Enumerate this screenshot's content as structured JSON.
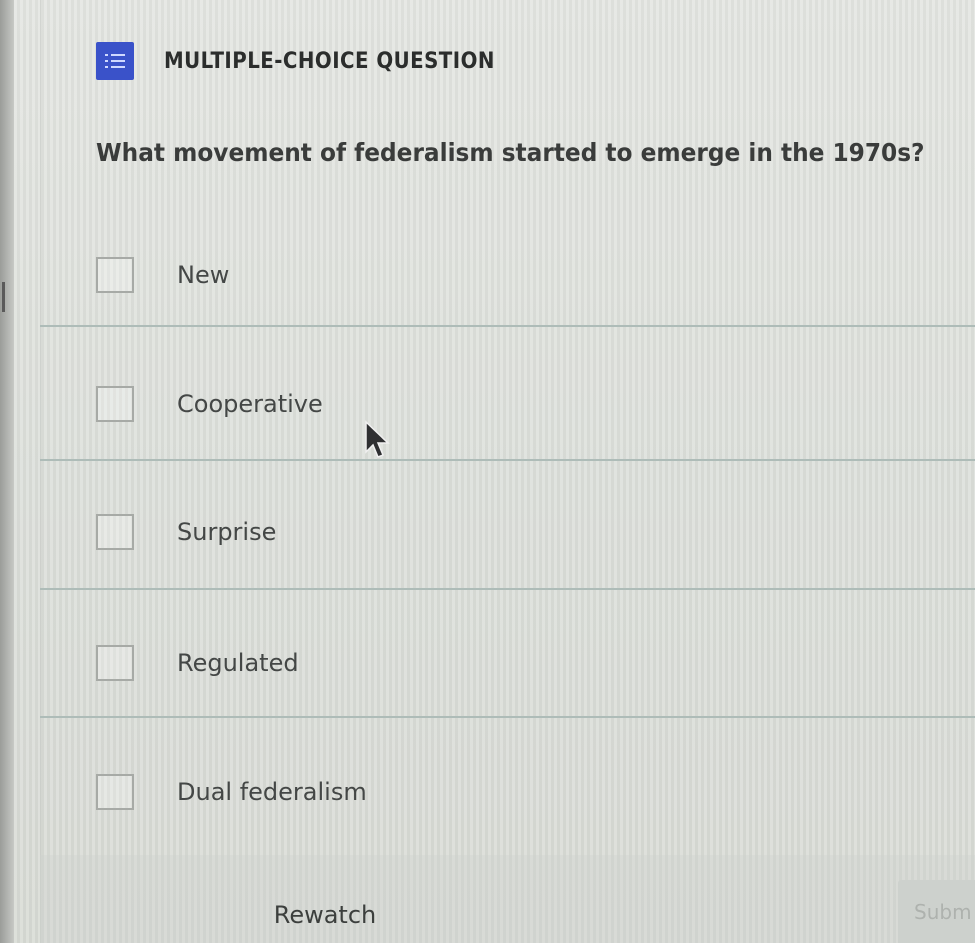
{
  "header": {
    "icon": "list-icon",
    "label": "MULTIPLE-CHOICE QUESTION",
    "icon_color": "#3a52c9"
  },
  "question": {
    "text": "What movement of federalism started to emerge in the 1970s?"
  },
  "options": [
    {
      "label": "New",
      "checked": false
    },
    {
      "label": "Cooperative",
      "checked": false
    },
    {
      "label": "Surprise",
      "checked": false
    },
    {
      "label": "Regulated",
      "checked": false
    },
    {
      "label": "Dual federalism",
      "checked": false
    }
  ],
  "footer": {
    "rewatch_label": "Rewatch",
    "submit_label": "Subm"
  }
}
